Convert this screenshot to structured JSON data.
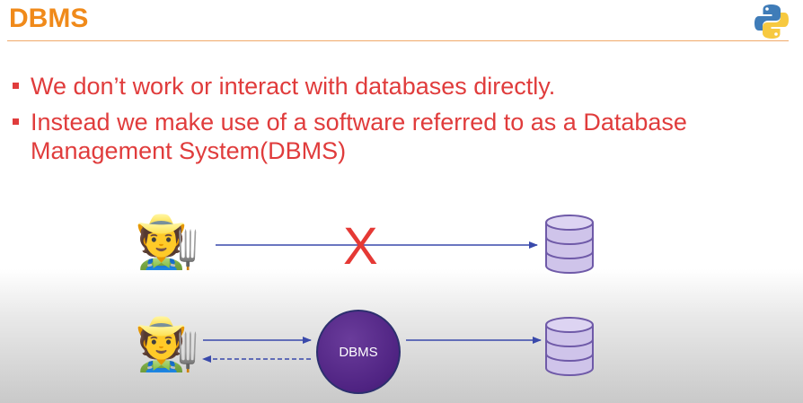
{
  "slide": {
    "title": "DBMS",
    "bullets": [
      "We don’t work or interact with databases directly.",
      "Instead we make use of a software referred to as a Database Management System(DBMS)"
    ]
  },
  "diagram": {
    "blocked_mark": "X",
    "dbms_label": "DBMS",
    "farmer_glyph": "🧑‍🌾"
  },
  "colors": {
    "title": "#f08a1a",
    "bullet_text": "#e03c3c",
    "arrow": "#3949ab",
    "database": "#cfc4ea",
    "database_stroke": "#6f5aa8",
    "dbms_circle": "#4f2382",
    "x_mark": "#e53935"
  }
}
